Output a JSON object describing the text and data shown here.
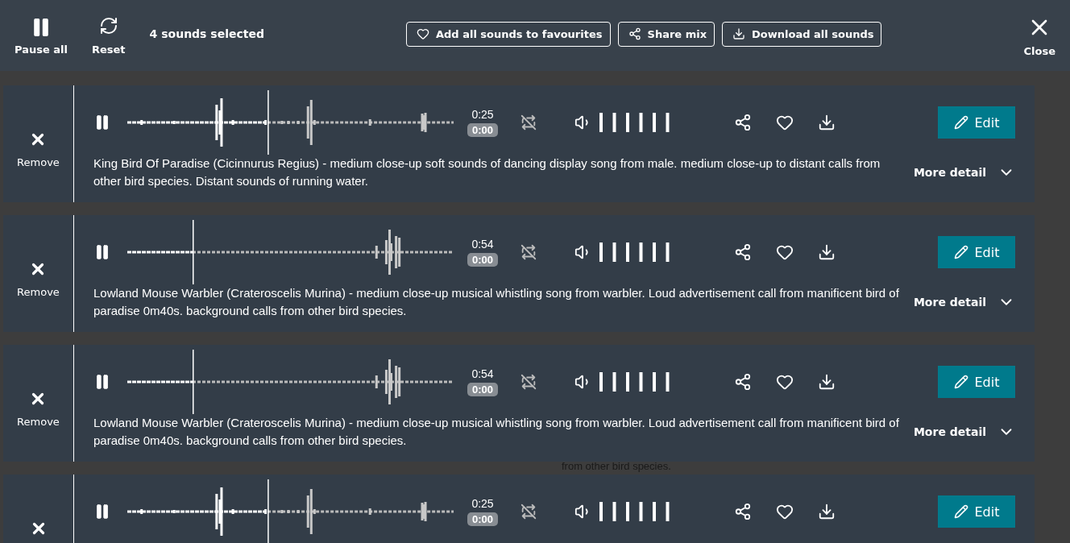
{
  "toolbar": {
    "pause_all": "Pause all",
    "reset": "Reset",
    "selection_count": "4 sounds selected",
    "actions": [
      "Add all sounds to favourites",
      "Share mix",
      "Download all sounds"
    ],
    "close": "Close"
  },
  "background_text": "from other bird species.",
  "sounds": [
    {
      "remove": "Remove",
      "duration": "0:25",
      "position": "0:00",
      "level": 0.43,
      "edit": "Edit",
      "description": "King Bird Of Paradise (Cicinnurus Regius) - medium close-up soft sounds of dancing display song from male. medium close-up to distant calls from other bird species. Distant sounds of running water.",
      "more": "More detail"
    },
    {
      "remove": "Remove",
      "duration": "0:54",
      "position": "0:00",
      "level": 0.2,
      "edit": "Edit",
      "description": "Lowland Mouse Warbler (Crateroscelis Murina) - medium close-up musical whistling song from warbler. Loud advertisement call from manificent bird of paradise 0m40s. background calls from other bird species.",
      "more": "More detail"
    },
    {
      "remove": "Remove",
      "duration": "0:54",
      "position": "0:00",
      "level": 0.2,
      "edit": "Edit",
      "description": "Lowland Mouse Warbler (Crateroscelis Murina) - medium close-up musical whistling song from warbler. Loud advertisement call from manificent bird of paradise 0m40s. background calls from other bird species.",
      "more": "More detail"
    },
    {
      "duration": "0:25",
      "position": "0:00",
      "level": 0.43,
      "edit": "Edit"
    }
  ]
}
